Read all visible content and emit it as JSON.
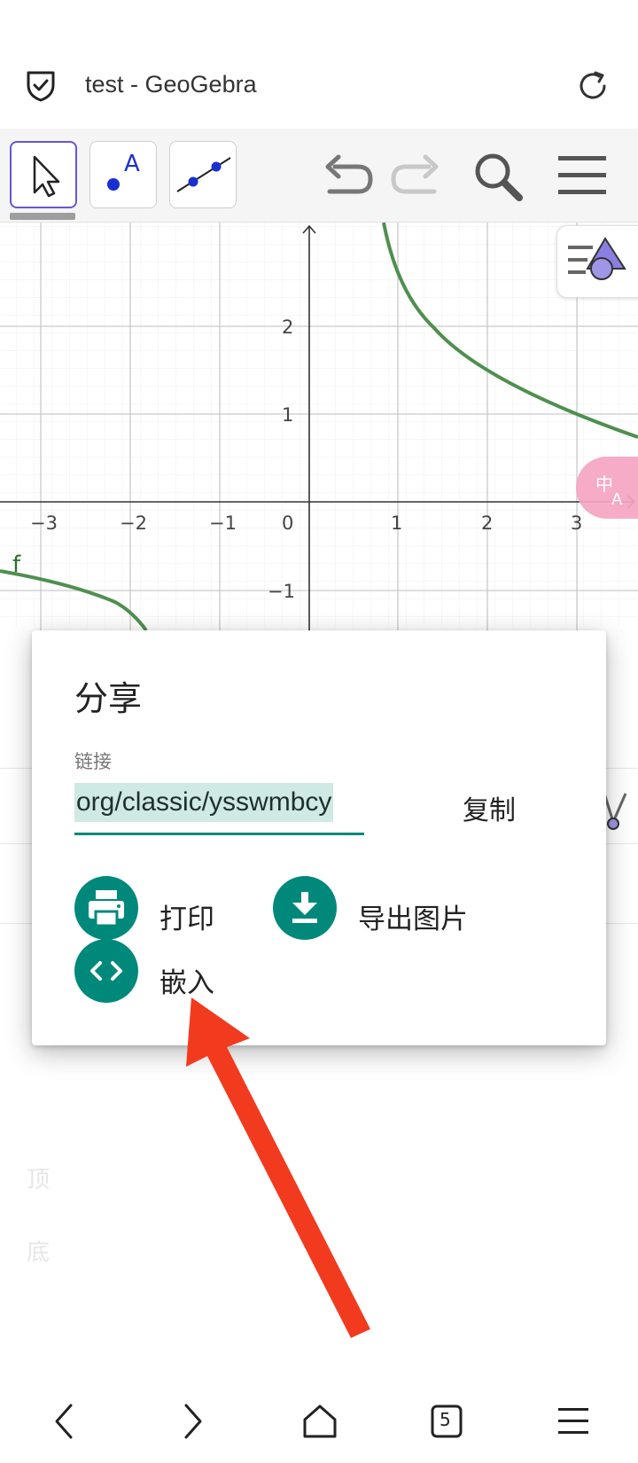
{
  "browser": {
    "page_title": "test - GeoGebra",
    "tab_count": "5"
  },
  "toolbar": {
    "tools": [
      "move-tool",
      "point-tool",
      "line-tool"
    ],
    "point_tool_letter": "A"
  },
  "graph": {
    "x_ticks": [
      "−3",
      "−2",
      "−1",
      "0",
      "1",
      "2",
      "3"
    ],
    "y_ticks": [
      "2",
      "1",
      "−1"
    ],
    "function_label": "f",
    "curve_color": "#4f8f4f",
    "accent": "#6557d2"
  },
  "dialog": {
    "title": "分享",
    "link_label": "链接",
    "link_value": "org/classic/ysswmbcy",
    "copy_label": "复制",
    "print_label": "打印",
    "export_label": "导出图片",
    "embed_label": "嵌入",
    "button_color": "#00897b"
  },
  "background_side": {
    "top_label": "顶",
    "bottom_label": "底"
  },
  "annotation": {
    "arrow_color": "#f23a1f"
  }
}
